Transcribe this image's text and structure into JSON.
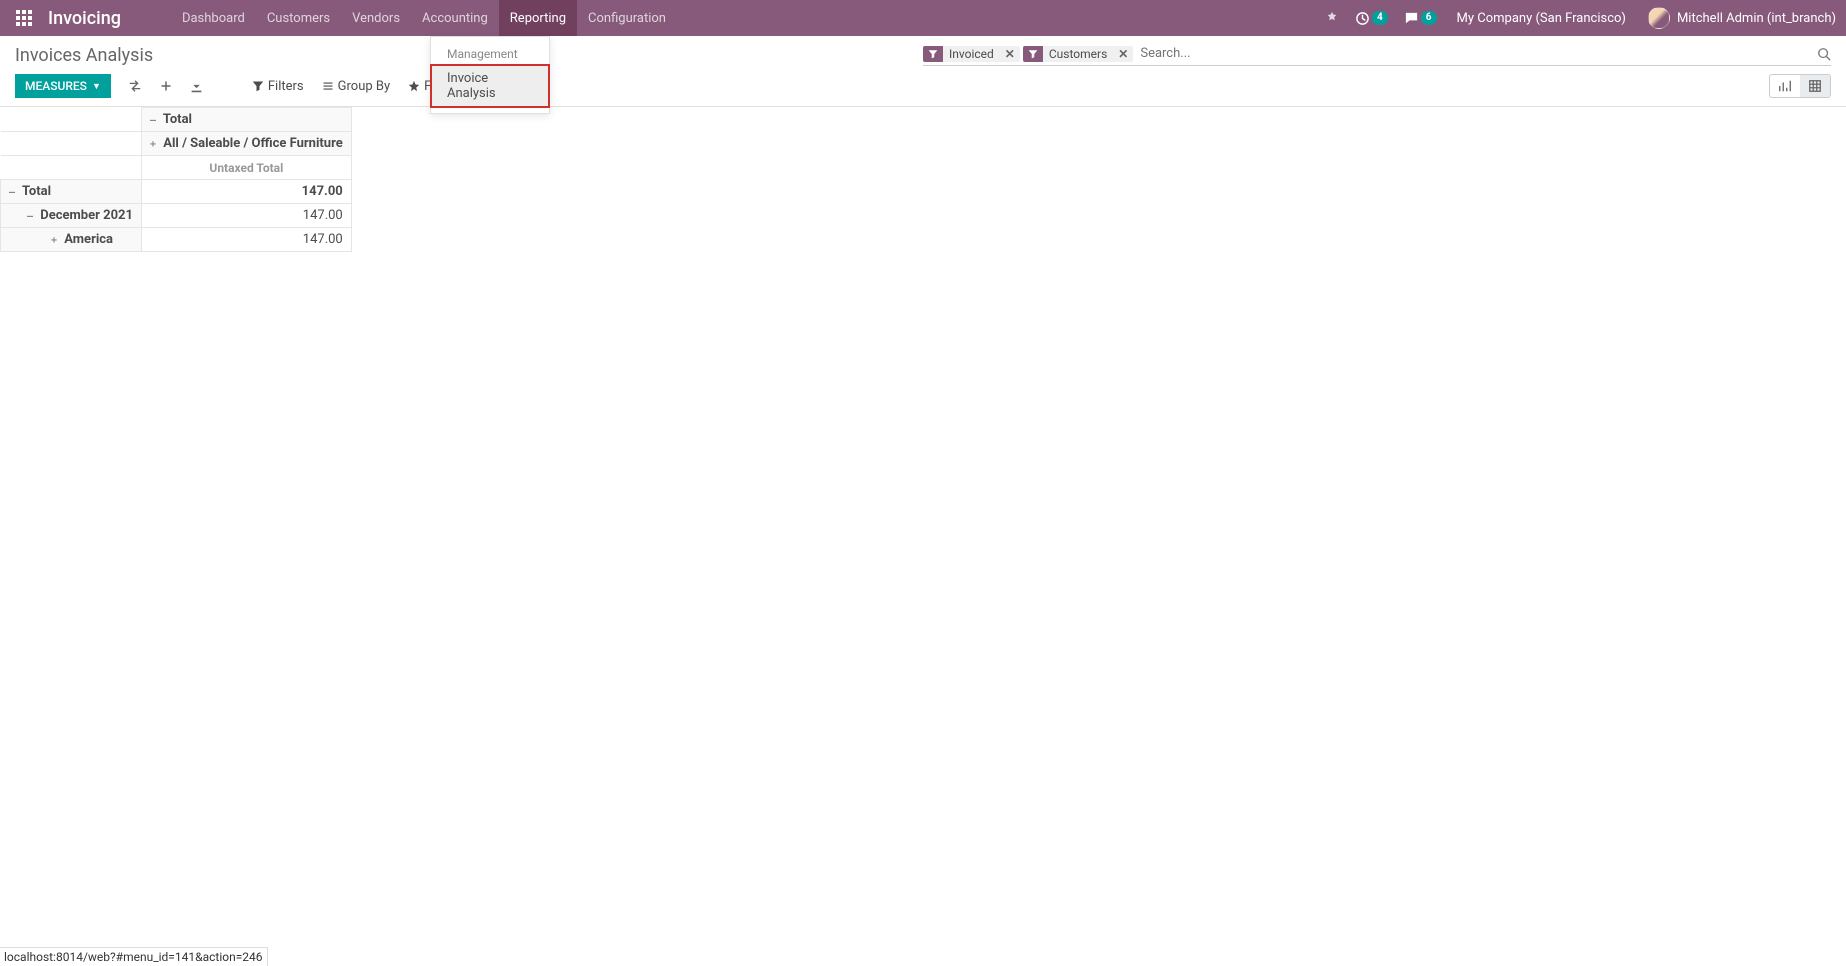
{
  "nav": {
    "brand": "Invoicing",
    "items": [
      "Dashboard",
      "Customers",
      "Vendors",
      "Accounting",
      "Reporting",
      "Configuration"
    ],
    "active_index": 4,
    "activity_badge": "4",
    "chat_badge": "6",
    "company": "My Company (San Francisco)",
    "user": "Mitchell Admin (int_branch)"
  },
  "dropdown": {
    "section": "Management",
    "item": "Invoice Analysis"
  },
  "page_title": "Invoices Analysis",
  "search": {
    "facets": [
      "Invoiced",
      "Customers"
    ],
    "placeholder": "Search..."
  },
  "toolbar": {
    "measures": "MEASURES",
    "filters": "Filters",
    "groupby": "Group By",
    "favorites": "Favorites"
  },
  "pivot": {
    "col_total": "Total",
    "col_group": "All / Saleable / Office Furniture",
    "measure": "Untaxed Total",
    "rows": {
      "total": {
        "label": "Total",
        "value": "147.00"
      },
      "r1": {
        "label": "December 2021",
        "value": "147.00"
      },
      "r2": {
        "label": "America",
        "value": "147.00"
      }
    }
  },
  "status_url": "localhost:8014/web?#menu_id=141&action=246",
  "chart_data": {
    "type": "table",
    "title": "Invoices Analysis",
    "measure": "Untaxed Total",
    "column_group": "All / Saleable / Office Furniture",
    "rows": [
      {
        "label": "Total",
        "value": 147.0
      },
      {
        "label": "December 2021",
        "value": 147.0
      },
      {
        "label": "America",
        "value": 147.0
      }
    ]
  }
}
